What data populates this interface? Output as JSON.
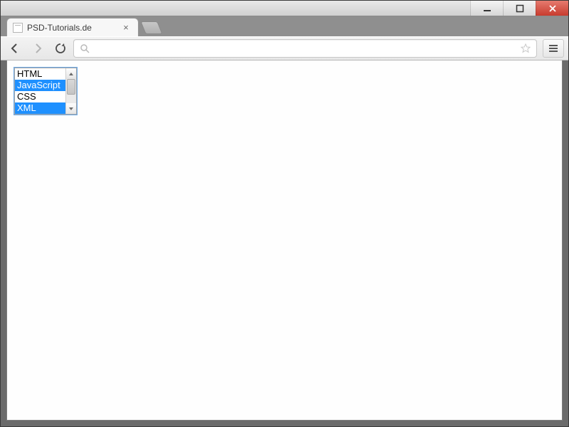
{
  "window": {
    "tab_title": "PSD-Tutorials.de"
  },
  "toolbar": {
    "url_value": "",
    "url_placeholder": ""
  },
  "listbox": {
    "options": [
      {
        "label": "HTML",
        "selected": false
      },
      {
        "label": "JavaScript",
        "selected": true
      },
      {
        "label": "CSS",
        "selected": false
      },
      {
        "label": "XML",
        "selected": true
      }
    ]
  }
}
